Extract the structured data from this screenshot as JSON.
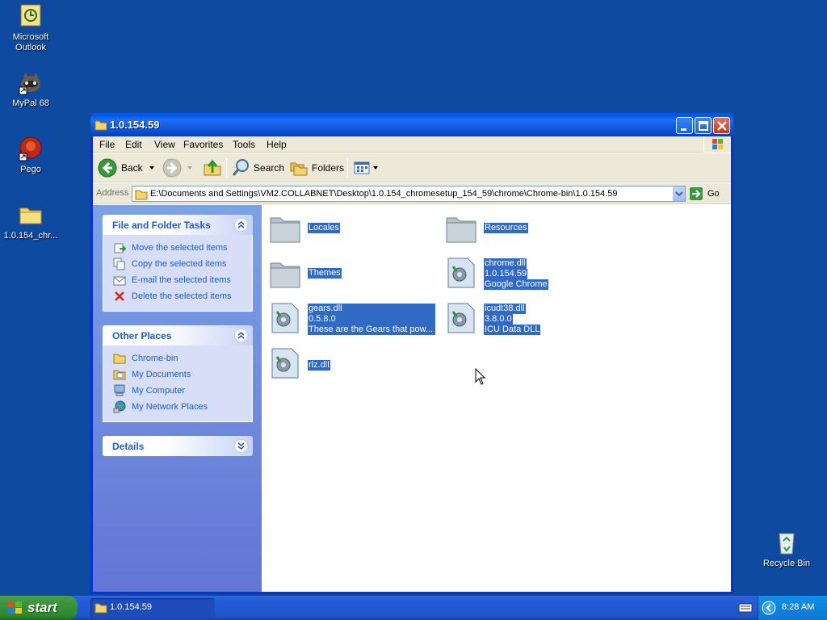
{
  "desktop": {
    "icons": [
      {
        "label_line1": "Microsoft",
        "label_line2": "Outlook"
      },
      {
        "label_line1": "MyPal 68",
        "label_line2": ""
      },
      {
        "label_line1": "Pego",
        "label_line2": ""
      },
      {
        "label_line1": "1.0.154_chr...",
        "label_line2": ""
      },
      {
        "label_line1": "Recycle Bin",
        "label_line2": ""
      }
    ]
  },
  "window": {
    "title": "1.0.154.59",
    "menu": [
      "File",
      "Edit",
      "View",
      "Favorites",
      "Tools",
      "Help"
    ],
    "toolbar": {
      "back_label": "Back",
      "search_label": "Search",
      "folders_label": "Folders"
    },
    "address": {
      "label": "Address",
      "path": "E:\\Documents and Settings\\VM2.COLLABNET\\Desktop\\1.0.154_chromesetup_154_59\\chrome\\Chrome-bin\\1.0.154.59",
      "go_label": "Go"
    },
    "panels": {
      "file_tasks": {
        "title": "File and Folder Tasks",
        "items": [
          "Move the selected items",
          "Copy the selected items",
          "E-mail the selected items",
          "Delete the selected items"
        ]
      },
      "other_places": {
        "title": "Other Places",
        "items": [
          "Chrome-bin",
          "My Documents",
          "My Computer",
          "My Network Places"
        ]
      },
      "details": {
        "title": "Details"
      }
    },
    "files": [
      {
        "name": "Locales",
        "kind": "folder",
        "line2": "",
        "line3": ""
      },
      {
        "name": "Resources",
        "kind": "folder",
        "line2": "",
        "line3": ""
      },
      {
        "name": "Themes",
        "kind": "folder",
        "line2": "",
        "line3": ""
      },
      {
        "name": "chrome.dll",
        "kind": "dll",
        "line2": "1.0.154.59",
        "line3": "Google Chrome"
      },
      {
        "name": "gears.dll",
        "kind": "dll",
        "line2": "0.5.8.0",
        "line3": "These are the Gears that pow..."
      },
      {
        "name": "icudt38.dll",
        "kind": "dll",
        "line2": "3.8.0.0",
        "line3": "ICU Data DLL"
      },
      {
        "name": "rlz.dll",
        "kind": "dll",
        "line2": "",
        "line3": ""
      }
    ],
    "selection_color": "#316ac5"
  },
  "taskbar": {
    "start_label": "start",
    "task_label": "1.0.154.59",
    "clock": "8:28 AM"
  }
}
